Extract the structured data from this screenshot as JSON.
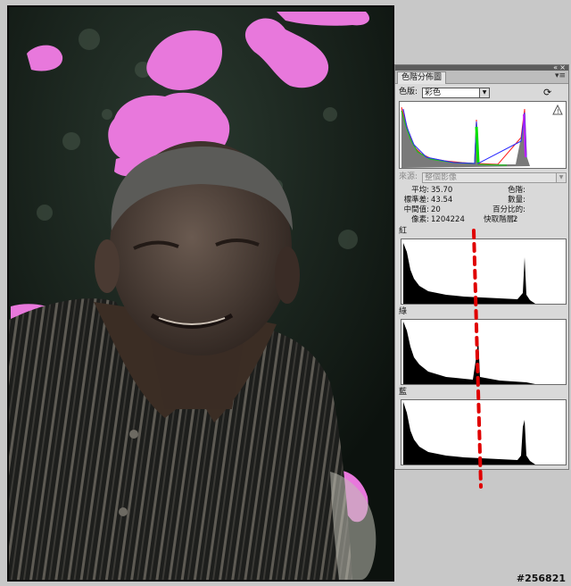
{
  "panel": {
    "title": "色階分佈圖",
    "channel_label": "色版:",
    "channel_value": "彩色",
    "source_label": "來源:",
    "source_value": "整個影像",
    "stats": {
      "mean_label": "平均:",
      "mean_value": "35.70",
      "stddev_label": "標準差:",
      "stddev_value": "43.54",
      "median_label": "中間值:",
      "median_value": "20",
      "pixels_label": "像素:",
      "pixels_value": "1204224",
      "level_label": "色階:",
      "count_label": "數量:",
      "percentile_label": "百分比的:",
      "cache_label": "快取階層:",
      "cache_value": "2"
    },
    "channels": [
      {
        "name": "紅"
      },
      {
        "name": "綠"
      },
      {
        "name": "藍"
      }
    ]
  },
  "watermark": "#256821",
  "colors": {
    "mask_pink": "#e878dc",
    "panel_bg": "#d9d9d9",
    "dash_red": "#e00000"
  }
}
